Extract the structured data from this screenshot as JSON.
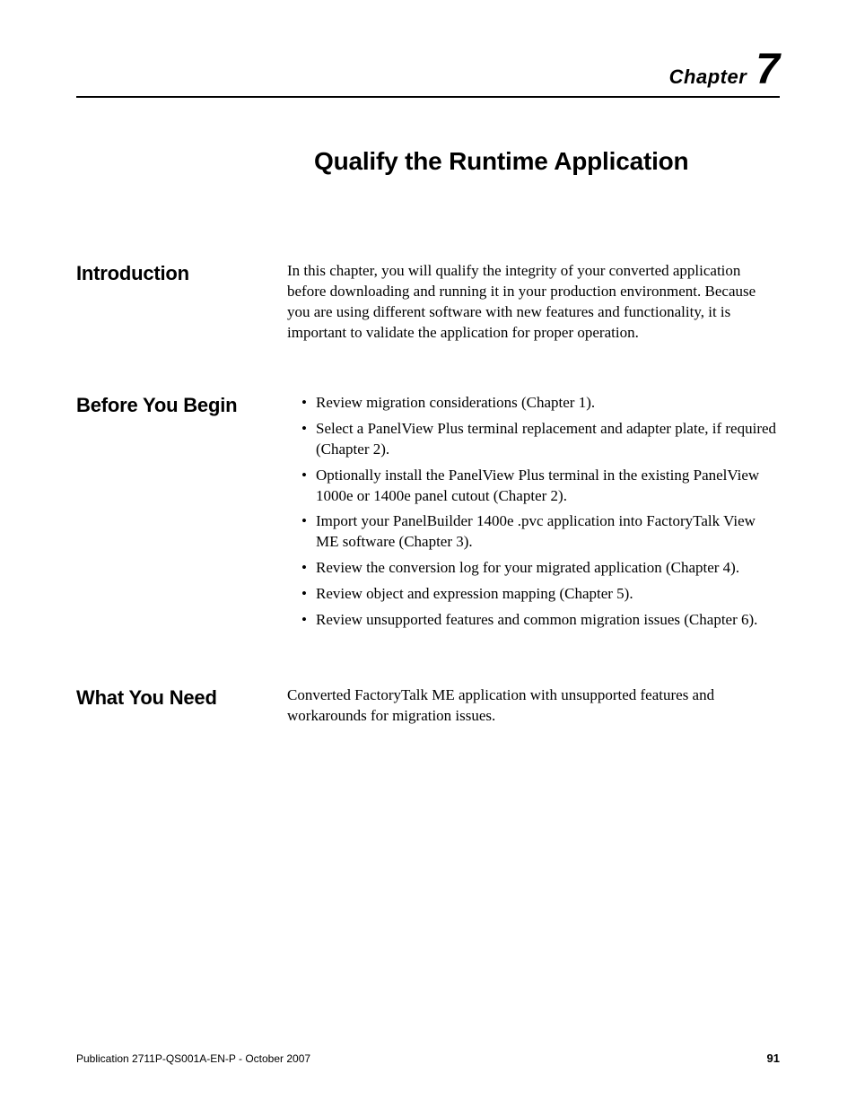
{
  "header": {
    "chapter_label": "Chapter",
    "chapter_number": "7"
  },
  "title": "Qualify the Runtime Application",
  "sections": {
    "introduction": {
      "heading": "Introduction",
      "body": "In this chapter, you will qualify the integrity of your converted application before downloading and running it in your production environment. Because you are using different software with new features and functionality, it is important to validate the application for proper operation."
    },
    "before": {
      "heading": "Before You Begin",
      "items": [
        "Review migration considerations (Chapter 1).",
        "Select a PanelView Plus terminal replacement and adapter plate, if required (Chapter 2).",
        "Optionally install the PanelView Plus terminal in the existing PanelView 1000e or 1400e panel cutout (Chapter 2).",
        "Import your PanelBuilder 1400e .pvc application into FactoryTalk View ME software (Chapter 3).",
        "Review the conversion log for your migrated application (Chapter 4).",
        "Review object and expression mapping (Chapter 5).",
        "Review unsupported features and common migration issues (Chapter 6)."
      ]
    },
    "need": {
      "heading": "What You Need",
      "body": "Converted FactoryTalk ME application with unsupported features and workarounds for migration issues."
    }
  },
  "footer": {
    "publication": "Publication 2711P-QS001A-EN-P - October 2007",
    "page": "91"
  }
}
